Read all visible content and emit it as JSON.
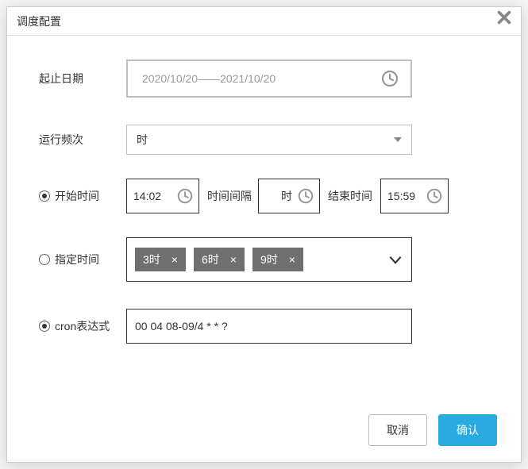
{
  "header": {
    "title": "调度配置"
  },
  "dateRange": {
    "label": "起止日期",
    "placeholder": "2020/10/20——2021/10/20"
  },
  "frequency": {
    "label": "运行频次",
    "value": "时"
  },
  "timeMode": {
    "radioLabel": "开始时间",
    "startValue": "14:02",
    "intervalLabel": "时间间隔",
    "intervalUnit": "时",
    "endLabel": "结束时间",
    "endValue": "15:59"
  },
  "fixedMode": {
    "radioLabel": "指定时间",
    "tags": [
      "3时",
      "6时",
      "9时"
    ]
  },
  "cronMode": {
    "radioLabel": "cron表达式",
    "value": "00 04 08-09/4 * * ?"
  },
  "footer": {
    "cancel": "取消",
    "confirm": "确认"
  }
}
